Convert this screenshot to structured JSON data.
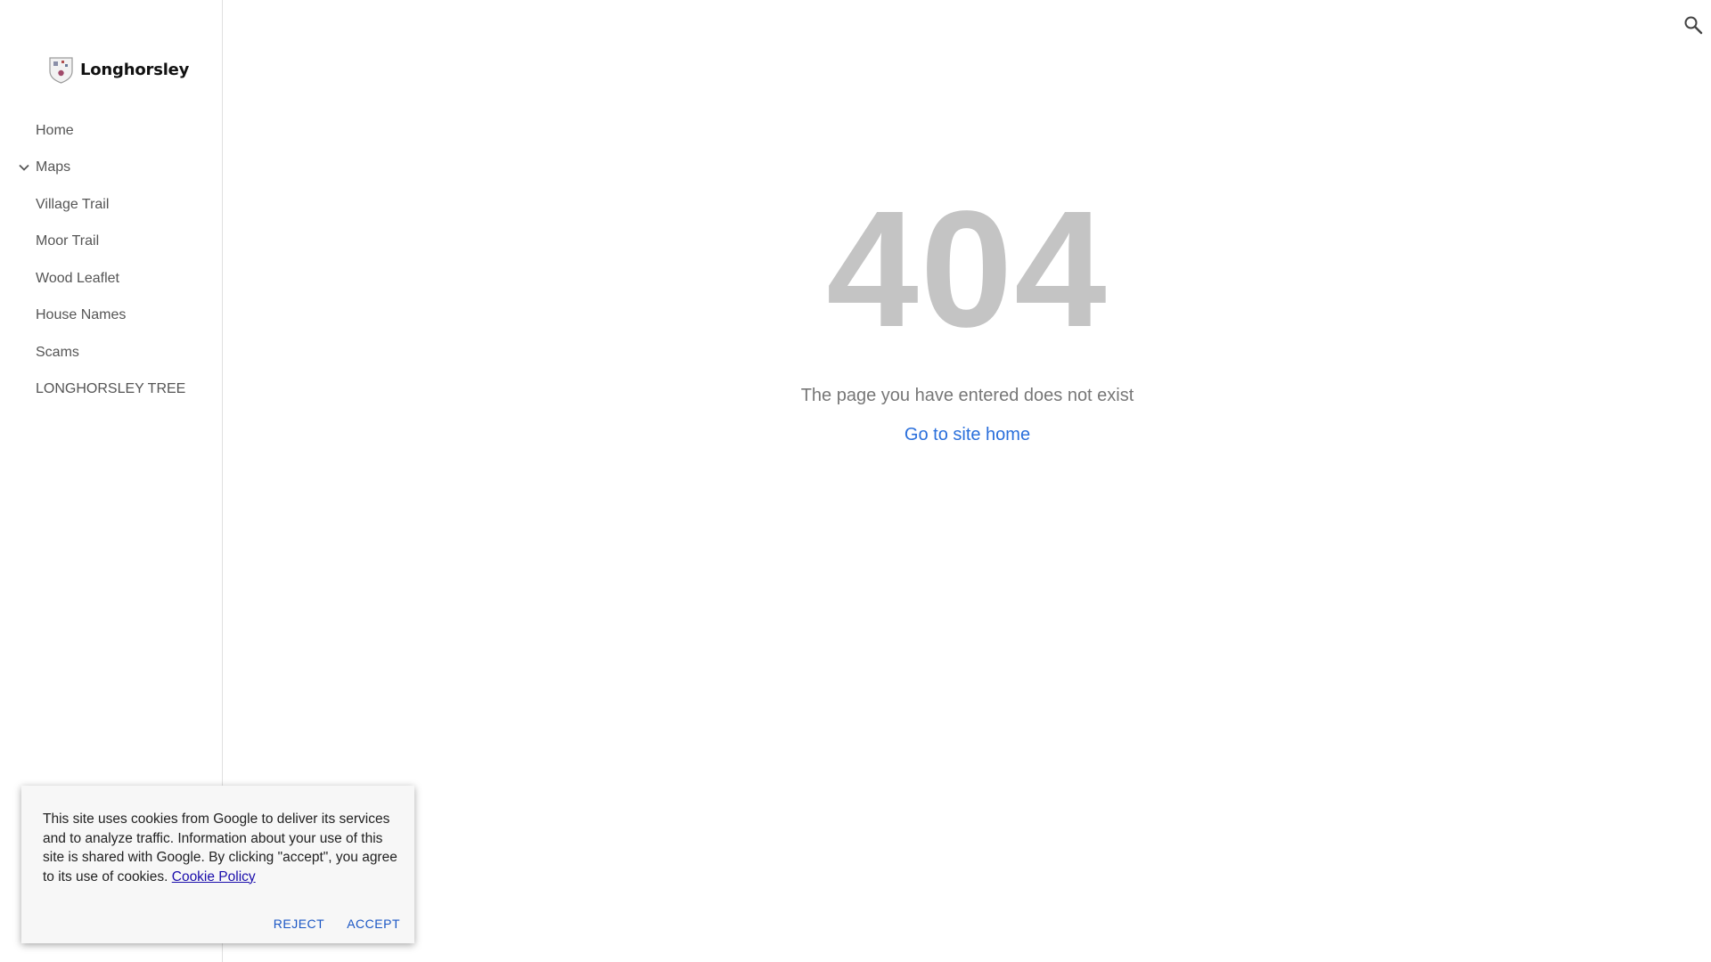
{
  "site": {
    "name": "Longhorsley"
  },
  "sidebar": {
    "items": [
      {
        "label": "Home",
        "has_chevron": false
      },
      {
        "label": "Maps",
        "has_chevron": true
      },
      {
        "label": "Village Trail",
        "has_chevron": false
      },
      {
        "label": "Moor Trail",
        "has_chevron": false
      },
      {
        "label": "Wood Leaflet",
        "has_chevron": false
      },
      {
        "label": "House Names",
        "has_chevron": false
      },
      {
        "label": "Scams",
        "has_chevron": false
      },
      {
        "label": "LONGHORSLEY TREE",
        "has_chevron": false
      }
    ]
  },
  "header": {
    "search_icon": "search-icon"
  },
  "main": {
    "error_code": "404",
    "message": "The page you have entered does not exist",
    "home_link": "Go to site home"
  },
  "cookie_banner": {
    "text": "This site uses cookies from Google to deliver its services and to analyze traffic. Information about your use of this site is shared with Google. By clicking \"accept\", you agree to its use of cookies.",
    "policy_link": "Cookie Policy",
    "reject_label": "REJECT",
    "accept_label": "ACCEPT"
  },
  "colors": {
    "accent": "#2a6fdb",
    "error_code": "#c4c4c4",
    "nav_text": "#555555"
  }
}
